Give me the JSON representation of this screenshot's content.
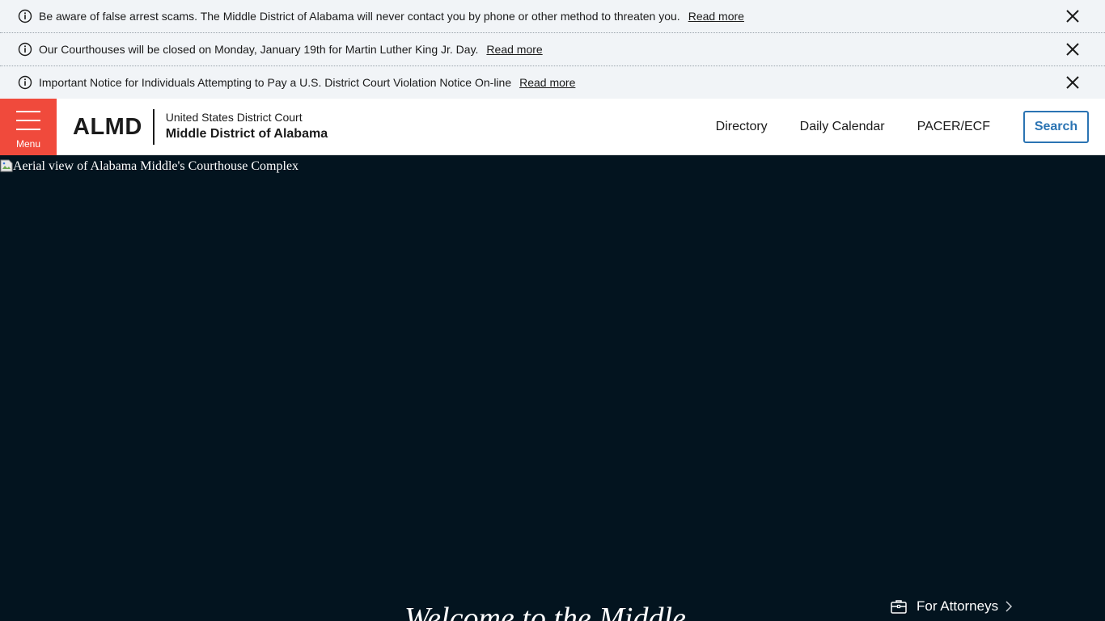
{
  "alerts": [
    {
      "text": "Be aware of false arrest scams. The Middle District of Alabama will never contact you by phone or other method to threaten you.",
      "link": "Read more"
    },
    {
      "text": "Our Courthouses will be closed on Monday, January 19th for Martin Luther King Jr. Day.",
      "link": "Read more"
    },
    {
      "text": "Important Notice for Individuals Attempting to Pay a U.S. District Court Violation Notice On-line",
      "link": "Read more"
    }
  ],
  "header": {
    "menu_label": "Menu",
    "logo_abbr": "ALMD",
    "court_line1": "United States District Court",
    "court_line2": "Middle District of Alabama",
    "nav": [
      "Directory",
      "Daily Calendar",
      "PACER/ECF"
    ],
    "search_label": "Search"
  },
  "hero": {
    "image_alt": "Aerial view of Alabama Middle's Courthouse Complex",
    "title": "Welcome to the Middle",
    "attorneys_link": "For Attorneys"
  },
  "colors": {
    "menu_bg": "#f04a3c",
    "hero_bg": "#03141f",
    "alert_bg": "#f1f4f7",
    "search_accent": "#2b74b3"
  },
  "icons": {
    "alert": "info-icon",
    "close": "close-icon",
    "menu": "hamburger-icon",
    "image": "broken-image-icon",
    "attorneys": "briefcase-icon",
    "arrow": "chevron-right-icon"
  }
}
